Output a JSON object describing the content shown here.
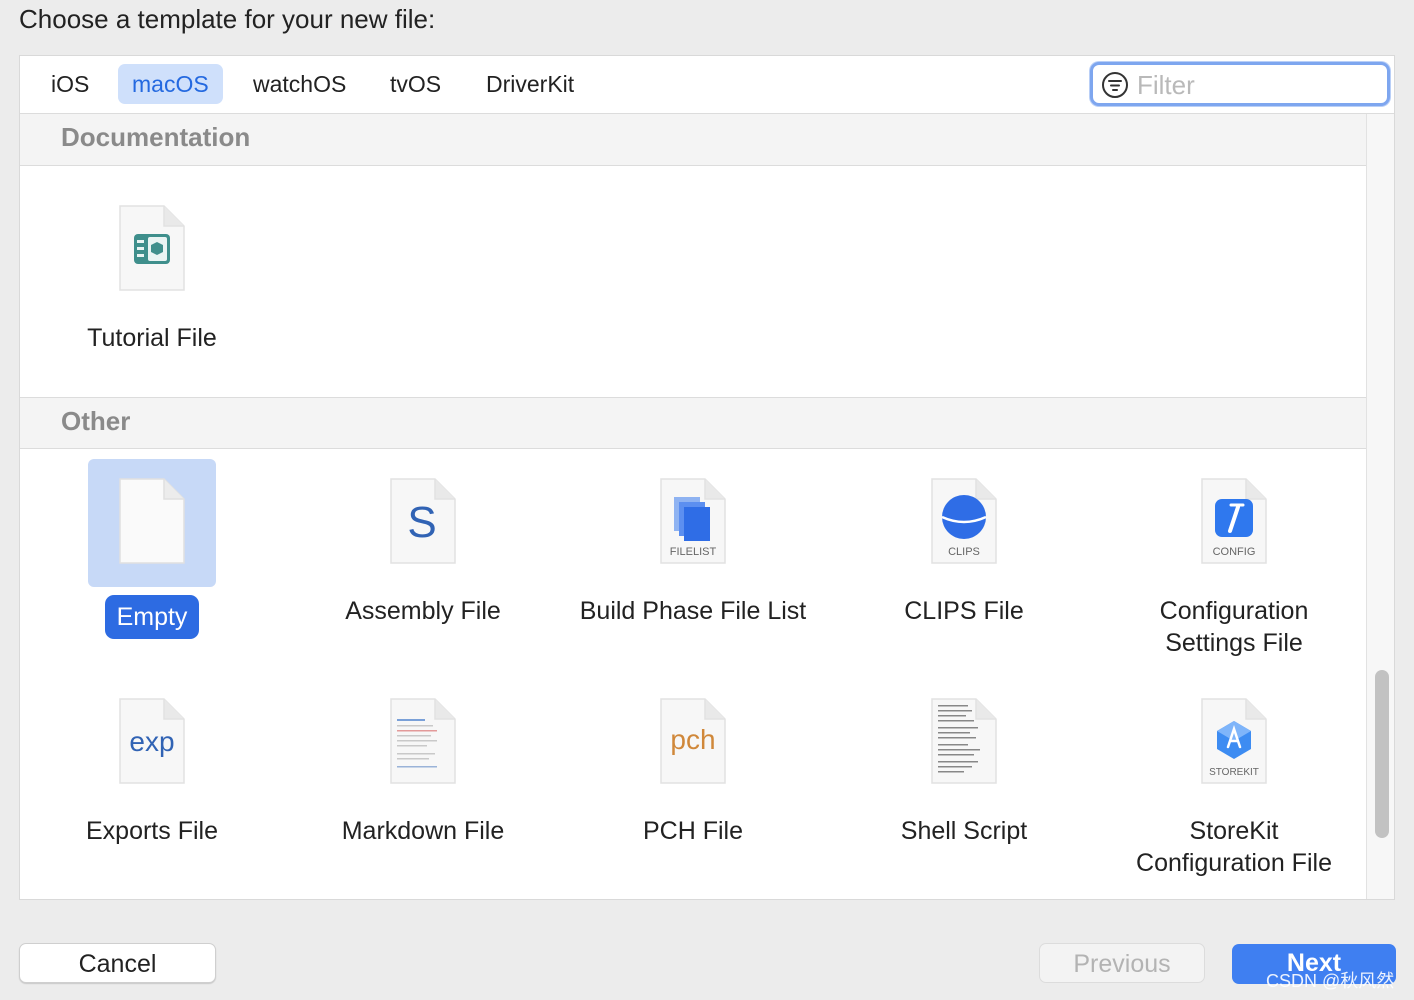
{
  "prompt": "Choose a template for your new file:",
  "tabs": [
    {
      "label": "iOS"
    },
    {
      "label": "macOS"
    },
    {
      "label": "watchOS"
    },
    {
      "label": "tvOS"
    },
    {
      "label": "DriverKit"
    }
  ],
  "active_tab": "macOS",
  "filter": {
    "placeholder": "Filter",
    "value": ""
  },
  "sections": [
    {
      "title": "Documentation",
      "items": [
        {
          "label": "Tutorial File",
          "icon": "tutorial-file-icon"
        }
      ]
    },
    {
      "title": "Other",
      "items": [
        {
          "label": "Empty",
          "icon": "empty-file-icon",
          "selected": true
        },
        {
          "label": "Assembly File",
          "icon": "assembly-file-icon",
          "glyph": "S"
        },
        {
          "label": "Build Phase File List",
          "icon": "filelist-icon",
          "badge": "FILELIST"
        },
        {
          "label": "CLIPS File",
          "icon": "clips-icon",
          "badge": "CLIPS"
        },
        {
          "label": "Configuration Settings File",
          "icon": "config-icon",
          "badge": "CONFIG"
        },
        {
          "label": "Exports File",
          "icon": "exports-file-icon",
          "glyph": "exp"
        },
        {
          "label": "Markdown File",
          "icon": "markdown-file-icon"
        },
        {
          "label": "PCH File",
          "icon": "pch-file-icon",
          "glyph": "pch"
        },
        {
          "label": "Shell Script",
          "icon": "shell-script-icon"
        },
        {
          "label": "StoreKit Configuration File",
          "icon": "storekit-icon",
          "badge": "STOREKIT"
        }
      ]
    }
  ],
  "buttons": {
    "cancel": "Cancel",
    "previous": "Previous",
    "next": "Next"
  },
  "watermark": "CSDN @秋风然",
  "colors": {
    "accent": "#2d6be2",
    "selection": "#c7d9f7",
    "next_button": "#3f7ff1"
  }
}
